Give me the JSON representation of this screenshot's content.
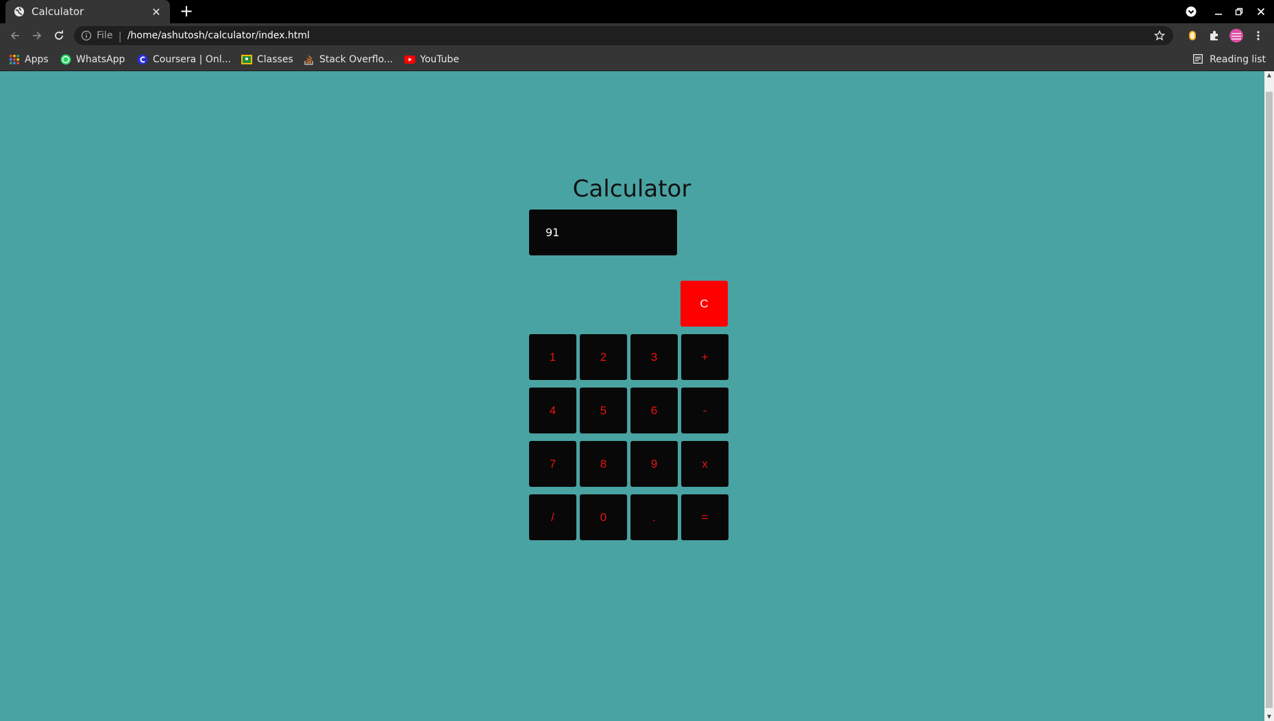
{
  "browser": {
    "tab_title": "Calculator",
    "tab_close": "✕",
    "new_tab": "+",
    "scheme": "File",
    "url": "/home/ashutosh/calculator/index.html",
    "bookmarks": [
      {
        "label": "Apps",
        "icon": "apps-grid-icon"
      },
      {
        "label": "WhatsApp",
        "icon": "whatsapp-icon"
      },
      {
        "label": "Coursera | Onl...",
        "icon": "coursera-icon"
      },
      {
        "label": "Classes",
        "icon": "classes-icon"
      },
      {
        "label": "Stack Overflo...",
        "icon": "stackoverflow-icon"
      },
      {
        "label": "YouTube",
        "icon": "youtube-icon"
      }
    ],
    "reading_list": "Reading list"
  },
  "calculator": {
    "title": "Calculator",
    "display": "91",
    "clear": "C",
    "keys": [
      "1",
      "2",
      "3",
      "+",
      "4",
      "5",
      "6",
      "-",
      "7",
      "8",
      "9",
      "x",
      "/",
      "0",
      ".",
      "="
    ]
  },
  "colors": {
    "page_background": "#4aa3a3",
    "key_background": "#080808",
    "key_text": "#ee1111",
    "clear_background": "#ff0000"
  }
}
